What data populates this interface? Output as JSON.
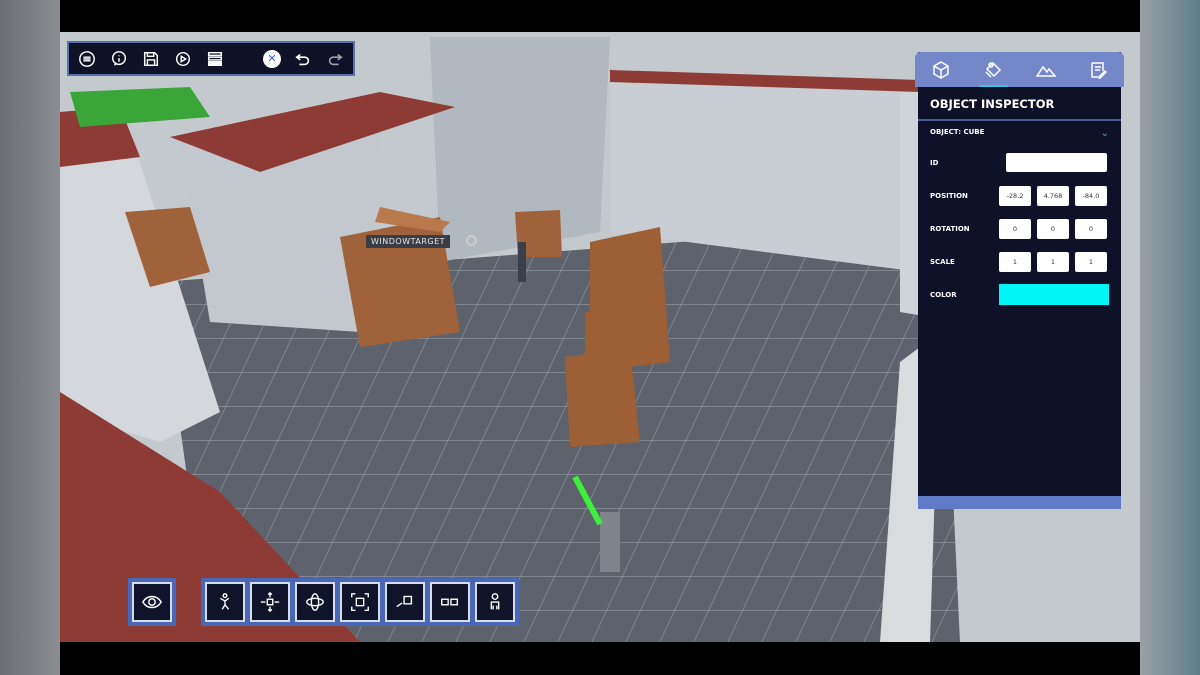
{
  "toolbar": {
    "icons": [
      "menu-icon",
      "info-icon",
      "save-icon",
      "play-icon",
      "layers-icon",
      "close-icon",
      "undo-icon",
      "redo-icon"
    ],
    "close_glyph": "✕"
  },
  "scene": {
    "target_label": "WINDOWTARGET"
  },
  "inspector": {
    "tabs": [
      "cube-icon",
      "paint-icon",
      "terrain-icon",
      "notes-icon"
    ],
    "title": "OBJECT INSPECTOR",
    "object_label": "OBJECT: CUBE",
    "chevron": "⌄",
    "id_label": "ID",
    "id_value": "",
    "position_label": "POSITION",
    "position": [
      "-28.2",
      "4.768",
      "-84.0"
    ],
    "rotation_label": "ROTATION",
    "rotation": [
      "0",
      "0",
      "0"
    ],
    "scale_label": "SCALE",
    "scale": [
      "1",
      "1",
      "1"
    ],
    "color_label": "COLOR",
    "color": "#00f6f6"
  },
  "bottom_tools": [
    "view-icon",
    "pose-icon",
    "move-icon",
    "rotate-icon",
    "focus-icon",
    "link-icon",
    "duplicate-icon",
    "character-icon"
  ]
}
